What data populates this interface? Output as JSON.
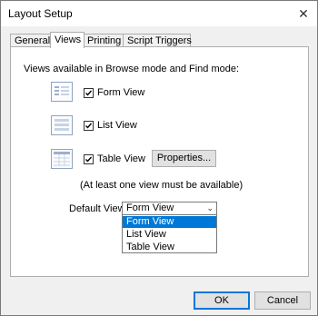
{
  "window": {
    "title": "Layout Setup",
    "close_glyph": "✕"
  },
  "tabs": [
    {
      "label": "General"
    },
    {
      "label": "Views"
    },
    {
      "label": "Printing"
    },
    {
      "label": "Script Triggers"
    }
  ],
  "views": {
    "heading": "Views available in Browse mode and Find mode:",
    "items": [
      {
        "label": "Form View",
        "checked": true,
        "icon": "form-view-icon"
      },
      {
        "label": "List View",
        "checked": true,
        "icon": "list-view-icon"
      },
      {
        "label": "Table View",
        "checked": true,
        "icon": "table-view-icon"
      }
    ],
    "properties_button": "Properties...",
    "note": "(At least one view must be available)"
  },
  "default_view": {
    "label": "Default View:",
    "selected": "Form View",
    "options": [
      "Form View",
      "List View",
      "Table View"
    ],
    "highlighted": "Form View"
  },
  "footer": {
    "ok": "OK",
    "cancel": "Cancel"
  },
  "colors": {
    "accent": "#0078d7",
    "icon_border": "#8fa3bf"
  }
}
